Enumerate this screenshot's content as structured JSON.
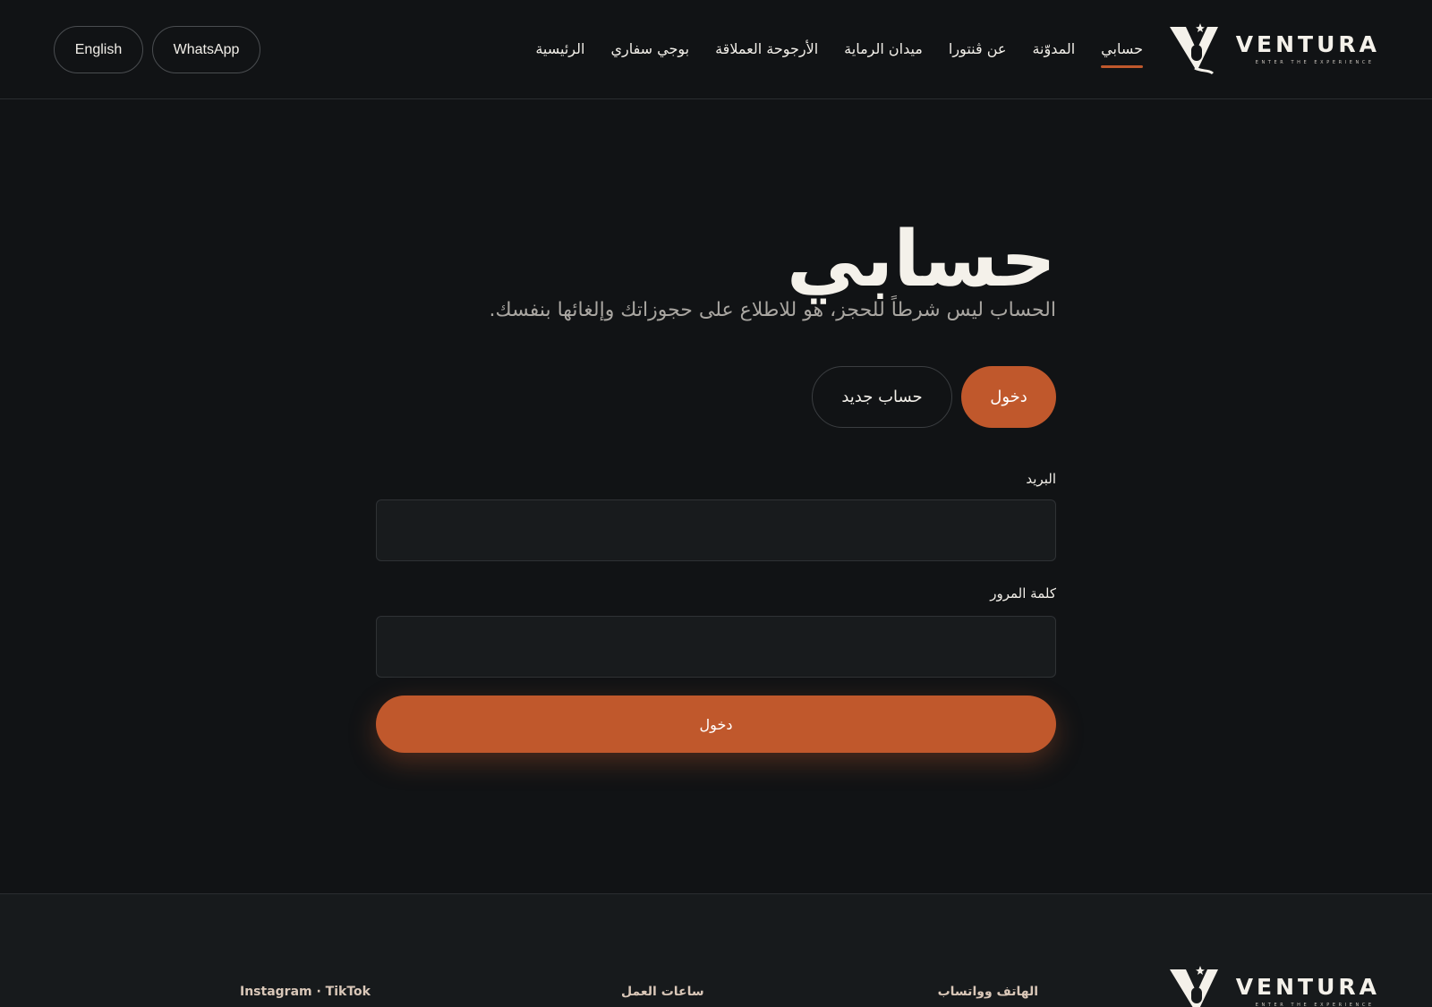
{
  "brand": {
    "name": "VENTURA",
    "tagline": "ENTER THE EXPERIENCE",
    "accent_color": "#c0582c",
    "background_color": "#111315"
  },
  "header": {
    "nav": [
      {
        "label": "الرئيسية",
        "active": false
      },
      {
        "label": "بوجي سفاري",
        "active": false
      },
      {
        "label": "الأرجوحة العملاقة",
        "active": false
      },
      {
        "label": "ميدان الرماية",
        "active": false
      },
      {
        "label": "عن ڤنتورا",
        "active": false
      },
      {
        "label": "المدوّنة",
        "active": false
      },
      {
        "label": "حسابي",
        "active": true
      }
    ],
    "whatsapp_label": "WhatsApp",
    "language_label": "English"
  },
  "account": {
    "title": "حسابي",
    "subtitle": "الحساب ليس شرطاً للحجز، هو للاطلاع على حجوزاتك وإلغائها بنفسك.",
    "tabs": {
      "login": "دخول",
      "register": "حساب جديد"
    },
    "active_tab": "login",
    "email_label": "البريد",
    "email_value": "",
    "password_label": "كلمة المرور",
    "password_value": "",
    "submit_label": "دخول"
  },
  "footer": {
    "phone_heading": "الهاتف وواتساب",
    "hours_heading": "ساعات العمل",
    "social_heading": "Instagram · TikTok"
  }
}
